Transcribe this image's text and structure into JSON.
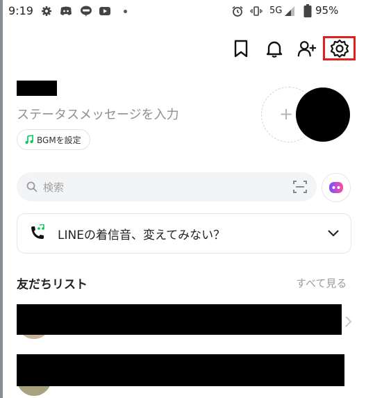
{
  "status_bar": {
    "time": "9:19",
    "network": "5G",
    "battery": "95%",
    "icons": [
      "gear-icon",
      "discord-icon",
      "line-icon",
      "youtube-icon",
      "alarm-icon",
      "vibrate-icon",
      "signal-icon",
      "battery-icon"
    ]
  },
  "header": {
    "icons": [
      "bookmark-icon",
      "bell-icon",
      "add-friend-icon",
      "settings-icon"
    ],
    "highlight_color": "#e0201c"
  },
  "profile": {
    "status_message_placeholder": "ステータスメッセージを入力",
    "bgm_label": "BGMを設定",
    "add_symbol": "+"
  },
  "search": {
    "placeholder": "検索"
  },
  "banner": {
    "text": "LINEの着信音、変えてみない？"
  },
  "friends": {
    "title": "友だちリスト",
    "see_all": "すべて見る"
  },
  "colors": {
    "accent_green": "#06c755",
    "muted_text": "#8f8f8f",
    "highlight_red": "#e0201c"
  }
}
